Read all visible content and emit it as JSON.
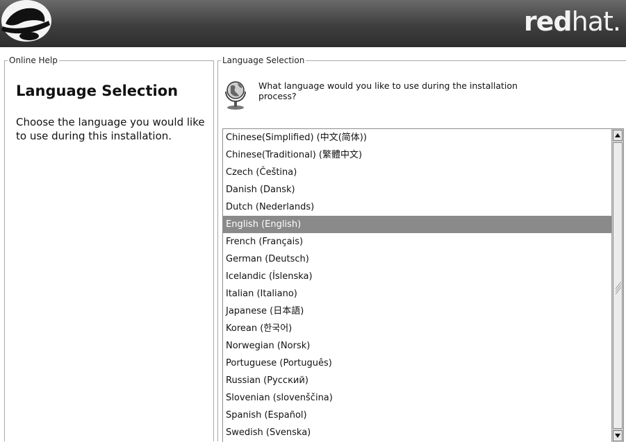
{
  "header": {
    "brand_bold": "red",
    "brand_light": "hat."
  },
  "help_panel": {
    "group_label": "Online Help",
    "title": "Language Selection",
    "body": "Choose the language you would like to use during this installation."
  },
  "language_panel": {
    "group_label": "Language Selection",
    "prompt": "What language would you like to use during the installation process?",
    "selected_index": 5,
    "languages": [
      "Chinese(Simplified) (中文(简体))",
      "Chinese(Traditional) (繁體中文)",
      "Czech (Čeština)",
      "Danish (Dansk)",
      "Dutch (Nederlands)",
      "English (English)",
      "French (Français)",
      "German (Deutsch)",
      "Icelandic (Íslenska)",
      "Italian (Italiano)",
      "Japanese (日本語)",
      "Korean (한국어)",
      "Norwegian (Norsk)",
      "Portuguese (Português)",
      "Russian (Русский)",
      "Slovenian (slovenščina)",
      "Spanish (Español)",
      "Swedish (Svenska)"
    ]
  },
  "colors": {
    "header_dark": "#2e2e2e",
    "selection": "#8a8a8a",
    "border": "#a8a8a8"
  },
  "icons": {
    "logo": "shadowman-hat-icon",
    "prompt": "globe-icon",
    "scroll_up": "arrow-up-icon",
    "scroll_down": "arrow-down-icon"
  }
}
